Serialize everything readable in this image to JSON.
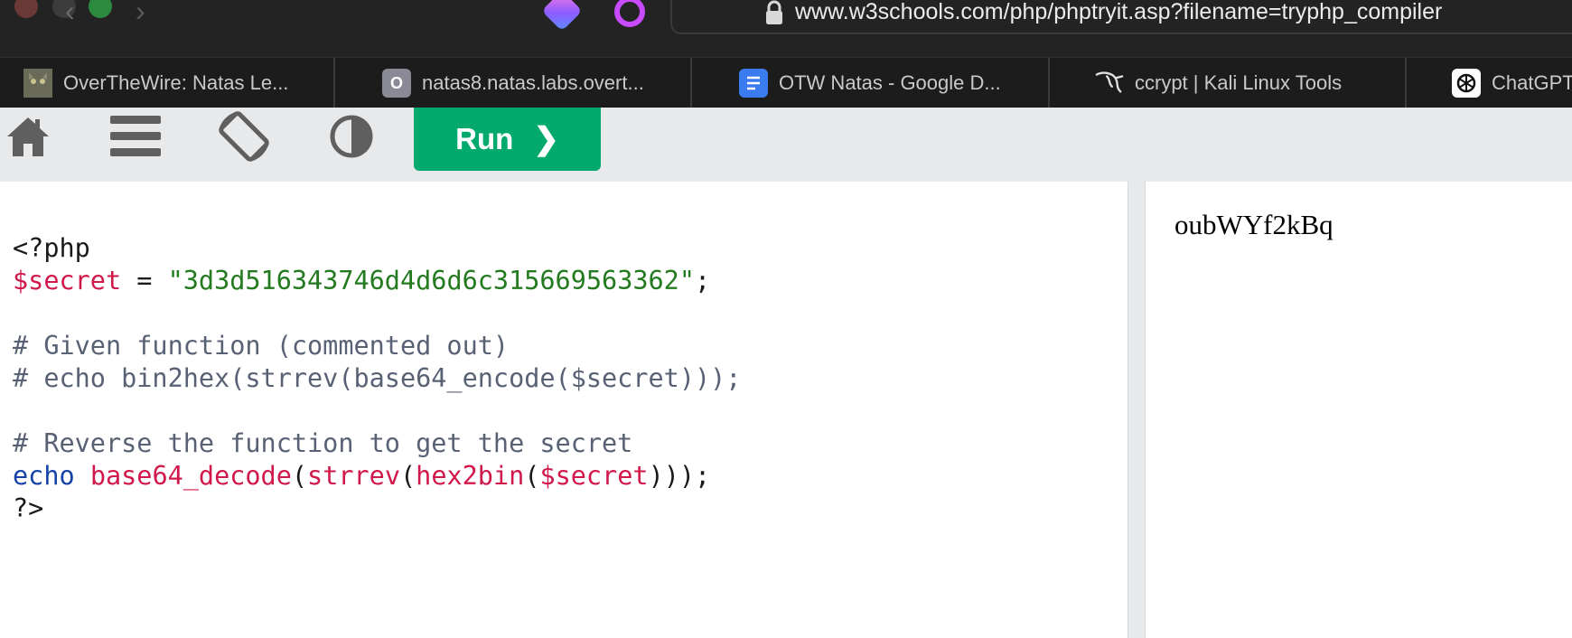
{
  "browser": {
    "url": "www.w3schools.com/php/phptryit.asp?filename=tryphp_compiler",
    "tabs": [
      {
        "label": "OverTheWire: Natas Le...",
        "icon": "cat-icon"
      },
      {
        "label": "natas8.natas.labs.overt...",
        "icon": "o-icon"
      },
      {
        "label": "OTW Natas - Google D...",
        "icon": "google-docs-icon"
      },
      {
        "label": "ccrypt | Kali Linux Tools",
        "icon": "kali-dragon-icon"
      },
      {
        "label": "ChatGPT - Overthew",
        "icon": "openai-icon"
      }
    ]
  },
  "toolbar": {
    "run_label": "Run",
    "run_color": "#04aa6d",
    "icons": [
      "home-icon",
      "menu-icon",
      "rotate-icon",
      "contrast-icon"
    ]
  },
  "editor": {
    "lines": [
      [],
      [
        {
          "t": "<?php",
          "c": "plain"
        }
      ],
      [
        {
          "t": "$secret",
          "c": "var"
        },
        {
          "t": " = ",
          "c": "plain"
        },
        {
          "t": "\"3d3d516343746d4d6d6c315669563362\"",
          "c": "str"
        },
        {
          "t": ";",
          "c": "plain"
        }
      ],
      [],
      [
        {
          "t": "# Given function (commented out)",
          "c": "com"
        }
      ],
      [
        {
          "t": "# echo bin2hex(strrev(base64_encode($secret)));",
          "c": "com"
        }
      ],
      [],
      [
        {
          "t": "# Reverse the function to get the secret",
          "c": "com"
        }
      ],
      [
        {
          "t": "echo",
          "c": "kw"
        },
        {
          "t": " ",
          "c": "plain"
        },
        {
          "t": "base64_decode",
          "c": "fn"
        },
        {
          "t": "(",
          "c": "plain"
        },
        {
          "t": "strrev",
          "c": "fn"
        },
        {
          "t": "(",
          "c": "plain"
        },
        {
          "t": "hex2bin",
          "c": "fn"
        },
        {
          "t": "(",
          "c": "plain"
        },
        {
          "t": "$secret",
          "c": "var"
        },
        {
          "t": ")));",
          "c": "plain"
        }
      ],
      [
        {
          "t": "?>",
          "c": "plain"
        }
      ]
    ]
  },
  "result": {
    "output": "oubWYf2kBq"
  }
}
